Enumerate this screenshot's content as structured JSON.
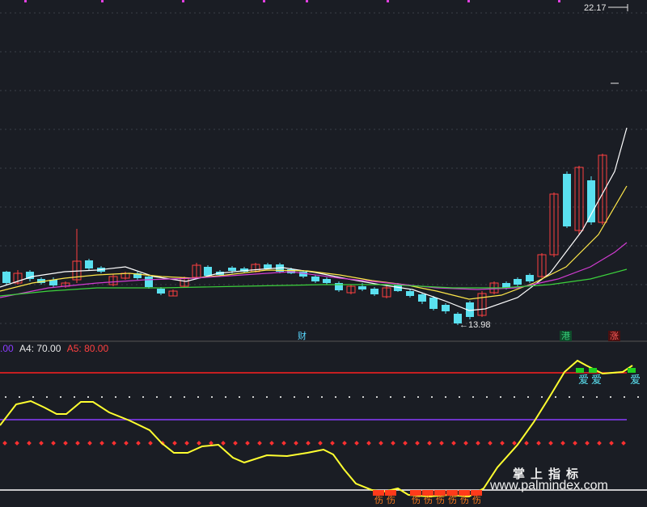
{
  "price_panel": {
    "high_label": "22.17",
    "low_label": "←13.98",
    "markers": [
      {
        "text": "财",
        "color": "#5ad8ff"
      },
      {
        "text": "港",
        "color": "#35d07a"
      },
      {
        "text": "涨",
        "color": "#ff5a5a"
      }
    ]
  },
  "indicator_panel": {
    "legend": [
      {
        "text": ".00",
        "color": "#8a3cff"
      },
      {
        "text": "A4: 70.00",
        "color": "#e8e8e8"
      },
      {
        "text": "A5: 80.00",
        "color": "#ff4040"
      }
    ],
    "signal_top_text": "爱",
    "signal_bottom_text": "伤"
  },
  "watermark": {
    "brand": "掌上指标",
    "url": "www.palmindex.com"
  },
  "colors": {
    "background": "#1a1d24",
    "up": "#ff4040",
    "down": "#5ae0f0",
    "ma_fast": "#ffffff",
    "ma_mid": "#ffe84a",
    "ma_slow": "#d23cd2",
    "ma_long": "#3cd23c",
    "line_a4": "#8a3cff",
    "line_a5": "#ff2020",
    "indicator": "#ffff30"
  }
}
